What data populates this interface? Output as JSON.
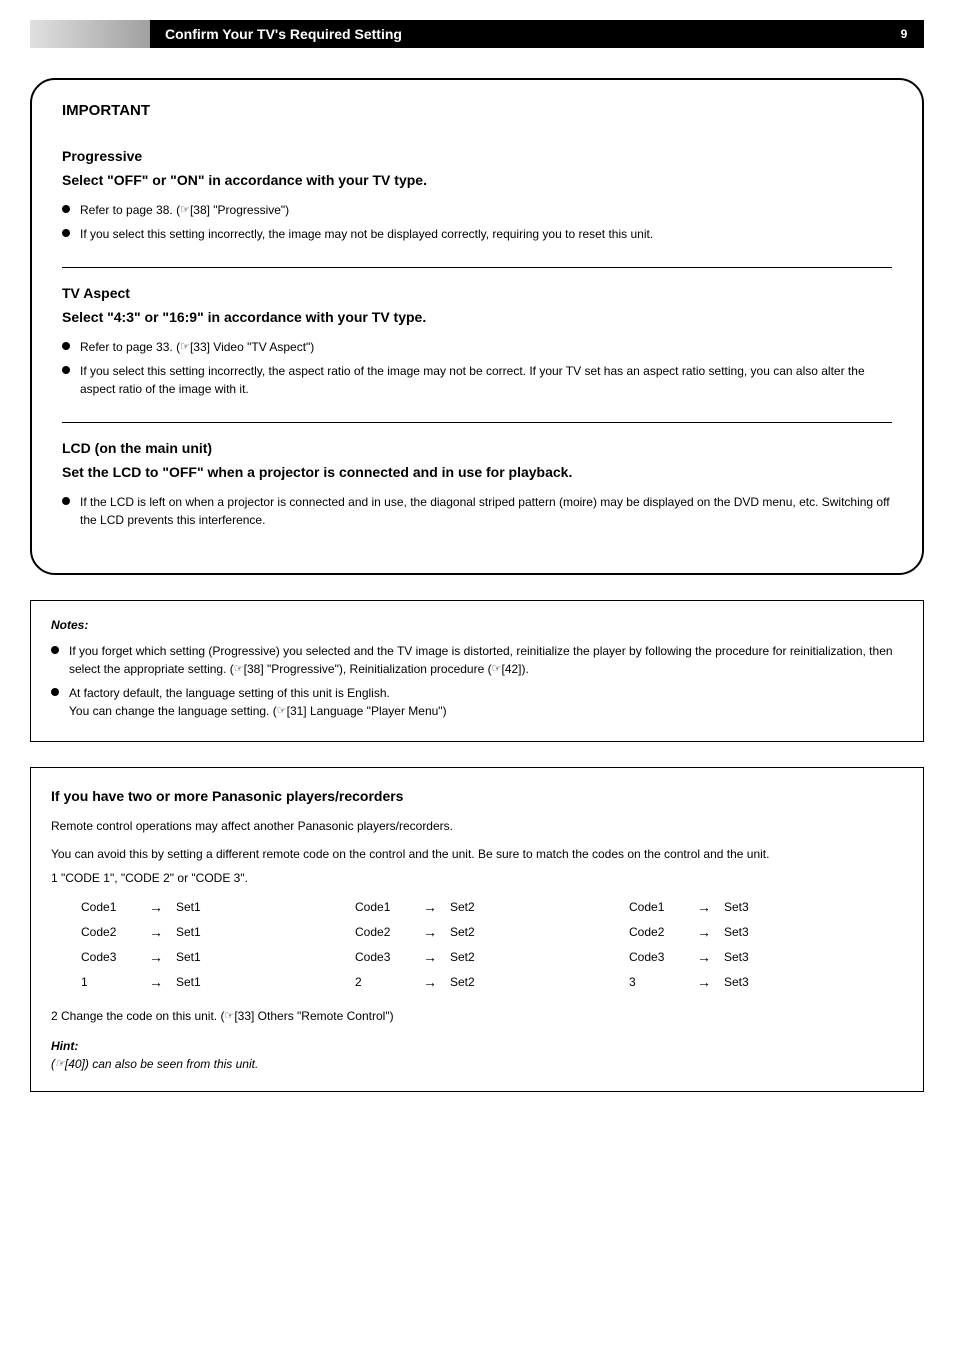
{
  "header": {
    "title": "Confirm Your TV's Required Setting",
    "page": "9"
  },
  "warning": {
    "title": "IMPORTANT",
    "sections": [
      {
        "label": "Progressive",
        "action": "Select \"OFF\" or \"ON\" in accordance with your TV type.",
        "bullets": [
          {
            "prefix": "Refer to page 38. (",
            "ref": "[38] \"Progressive\")",
            "suffix": ""
          },
          {
            "text": "If you select this setting incorrectly, the image may not be displayed correctly, requiring you to reset this unit."
          }
        ]
      },
      {
        "label": "TV Aspect",
        "action": "Select \"4:3\" or \"16:9\" in accordance with your TV type.",
        "bullets": [
          {
            "prefix": "Refer to page 33. (",
            "ref": "[33] Video",
            "suffix": " \"TV Aspect\")"
          },
          {
            "text": "If you select this setting incorrectly, the aspect ratio of the image may not be correct. If your TV set has an aspect ratio setting, you can also alter the aspect ratio of the image with it."
          }
        ]
      },
      {
        "label": "LCD (on the main unit)",
        "action": "Set the LCD to \"OFF\" when a projector is connected and in use for playback.",
        "bullets": [
          {
            "text": "If the LCD is left on when a projector is connected and in use, the diagonal striped pattern (moire) may be displayed on the DVD menu, etc. Switching off the LCD prevents this interference."
          }
        ]
      }
    ]
  },
  "notes": {
    "label": "Notes:",
    "items": [
      {
        "text_before": "If you forget which setting (Progressive) you selected and the TV image is distorted, reinitialize the player by following the procedure for reinitialization, then select the appropriate setting. (",
        "ref1": "[38] \"Progressive\"),",
        "text_mid": " Reinitialization procedure (",
        "ref2": "[42]).",
        "text_after": ""
      },
      {
        "text_before": "At factory default, the language setting of this unit is English.",
        "br": true,
        "text_mid": "You can change the language setting. (",
        "ref": "[31] Language \"Player Menu\")",
        "text_after": ""
      }
    ]
  },
  "remote": {
    "title": "If you have two or more Panasonic players/recorders",
    "subtitle": "Remote control operations may affect another Panasonic players/recorders.",
    "text1": "You can avoid this by setting a different remote code on the control and the unit. Be sure to match the codes on the control and the unit.",
    "codes_header": "1 \"CODE 1\", \"CODE 2\" or \"CODE 3\".",
    "codes": [
      {
        "col": 1,
        "label": "Code1",
        "value": "Set1"
      },
      {
        "col": 1,
        "label": "Code2",
        "value": "Set1"
      },
      {
        "col": 1,
        "label": "Code3",
        "value": "Set1"
      },
      {
        "col": 1,
        "label": "1",
        "value": "Set1"
      },
      {
        "col": 2,
        "label": "Code1",
        "value": "Set2"
      },
      {
        "col": 2,
        "label": "Code2",
        "value": "Set2"
      },
      {
        "col": 2,
        "label": "Code3",
        "value": "Set2"
      },
      {
        "col": 2,
        "label": "2",
        "value": "Set2"
      },
      {
        "col": 3,
        "label": "Code1",
        "value": "Set3"
      },
      {
        "col": 3,
        "label": "Code2",
        "value": "Set3"
      },
      {
        "col": 3,
        "label": "Code3",
        "value": "Set3"
      },
      {
        "col": 3,
        "label": "3",
        "value": "Set3"
      }
    ],
    "ref_text": "2 Change the code on this unit. (",
    "ref": "[33] Others \"Remote Control\")",
    "hint_label": "Hint:",
    "hint_text": "(",
    "hint_ref": "[40]) can also be seen from this unit."
  }
}
